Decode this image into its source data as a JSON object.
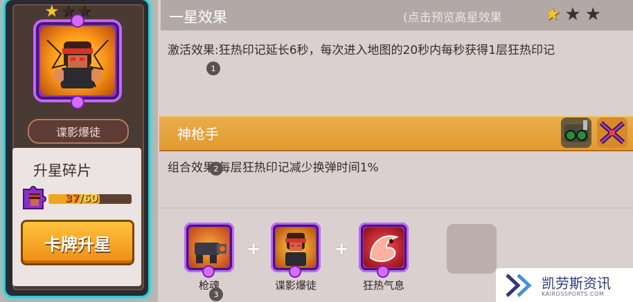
{
  "card": {
    "stars": [
      "gold",
      "dark",
      "dark"
    ],
    "name": "谍影爆徒",
    "fragment_title": "升星碎片",
    "fragment_current": "37",
    "fragment_sep": "/",
    "fragment_total": "60",
    "fragment_progress": 0.6167,
    "upgrade_label": "卡牌升星"
  },
  "header": {
    "title": "一星效果",
    "preview_label": "(点击预览高星效果",
    "stars": [
      "gold",
      "dark",
      "dark"
    ]
  },
  "effect": {
    "text": "激活效果:狂热印记延长6秒，每次进入地图的20秒内每秒获得1层狂热印记"
  },
  "set": {
    "name": "神枪手",
    "icons": [
      "goggles-icon",
      "crossed-guns-icon"
    ],
    "combo_text": "组合效果:每层狂热印记减少换弹时间1%"
  },
  "requirements": [
    {
      "label": "枪魂",
      "icon": "cannon-icon"
    },
    {
      "label": "谍影爆徒",
      "icon": "ninja-portrait-icon"
    },
    {
      "label": "狂热气息",
      "icon": "fire-dragon-icon"
    }
  ],
  "markers": [
    "1",
    "2",
    "3"
  ],
  "watermark": {
    "title": "凯劳斯资讯",
    "subtitle": "KAIROSSPORTS.COM"
  },
  "colors": {
    "accent_orange": "#e9ad4c",
    "card_glow": "#3bd7ea",
    "rarity_purple": "#8a30c9",
    "progress": "#f1a621"
  }
}
